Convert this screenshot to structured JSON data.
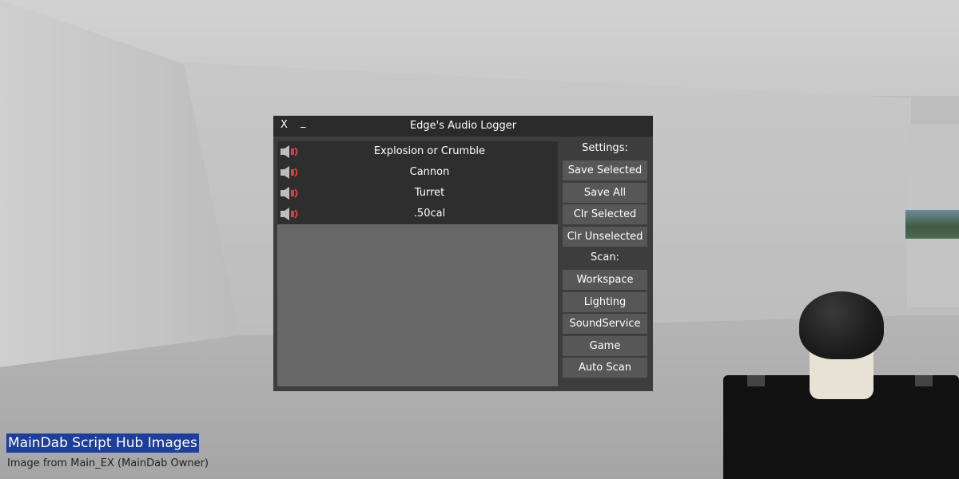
{
  "window": {
    "close_label": "X",
    "minimize_label": "_",
    "title": "Edge's Audio Logger"
  },
  "audio_list": [
    {
      "name": "Explosion or Crumble",
      "icon": "speaker-icon"
    },
    {
      "name": "Cannon",
      "icon": "speaker-icon"
    },
    {
      "name": "Turret",
      "icon": "speaker-icon"
    },
    {
      "name": ".50cal",
      "icon": "speaker-icon"
    }
  ],
  "settings": {
    "label": "Settings:",
    "buttons": [
      "Save Selected",
      "Save All",
      "Clr Selected",
      "Clr Unselected"
    ]
  },
  "scan": {
    "label": "Scan:",
    "buttons": [
      "Workspace",
      "Lighting",
      "SoundService",
      "Game",
      "Auto Scan"
    ]
  },
  "watermark": {
    "title": "MainDab Script Hub Images",
    "subtitle": "Image from Main_EX (MainDab Owner)"
  },
  "colors": {
    "titlebar": "#2a2a2a",
    "panel": "#3d3d3d",
    "button": "#575757",
    "list_bg": "#676767",
    "watermark_bg": "#1d3f9b",
    "speaker_wave": "#e23b3b"
  }
}
